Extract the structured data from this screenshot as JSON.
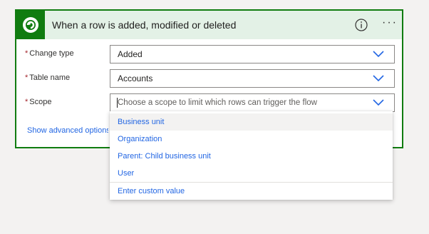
{
  "card": {
    "title": "When a row is added, modified or deleted",
    "header_color": "#e3f1e6",
    "border_color": "#107c10",
    "logo_icon": "dataverse-logo-icon",
    "info_icon": "info-icon",
    "more_label": "···"
  },
  "fields": {
    "change_type": {
      "required_mark": "*",
      "label": "Change type",
      "value": "Added"
    },
    "table_name": {
      "required_mark": "*",
      "label": "Table name",
      "value": "Accounts"
    },
    "scope": {
      "required_mark": "*",
      "label": "Scope",
      "placeholder": "Choose a scope to limit which rows can trigger the flow"
    }
  },
  "advanced_link": "Show advanced options",
  "dropdown": {
    "options": [
      "Business unit",
      "Organization",
      "Parent: Child business unit",
      "User"
    ],
    "highlighted": "Business unit",
    "custom_value": "Enter custom value"
  },
  "colors": {
    "link": "#2266e3",
    "required": "#a4262c",
    "chevron": "#2266e3"
  }
}
